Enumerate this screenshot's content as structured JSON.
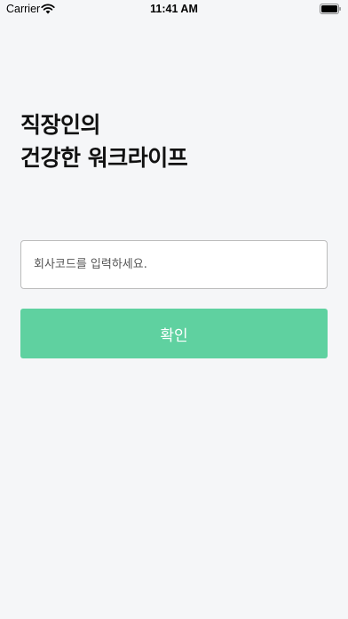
{
  "status_bar": {
    "carrier": "Carrier",
    "time": "11:41 AM"
  },
  "headline": {
    "line1": "직장인의",
    "line2": "건강한 워크라이프"
  },
  "company_code": {
    "placeholder": "회사코드를 입력하세요.",
    "value": ""
  },
  "confirm_button": {
    "label": "확인"
  },
  "colors": {
    "background": "#f5f6f8",
    "accent": "#5fd1a0",
    "input_border": "#bcbcbc"
  },
  "icons": {
    "wifi": "wifi-icon",
    "battery": "battery-icon"
  }
}
